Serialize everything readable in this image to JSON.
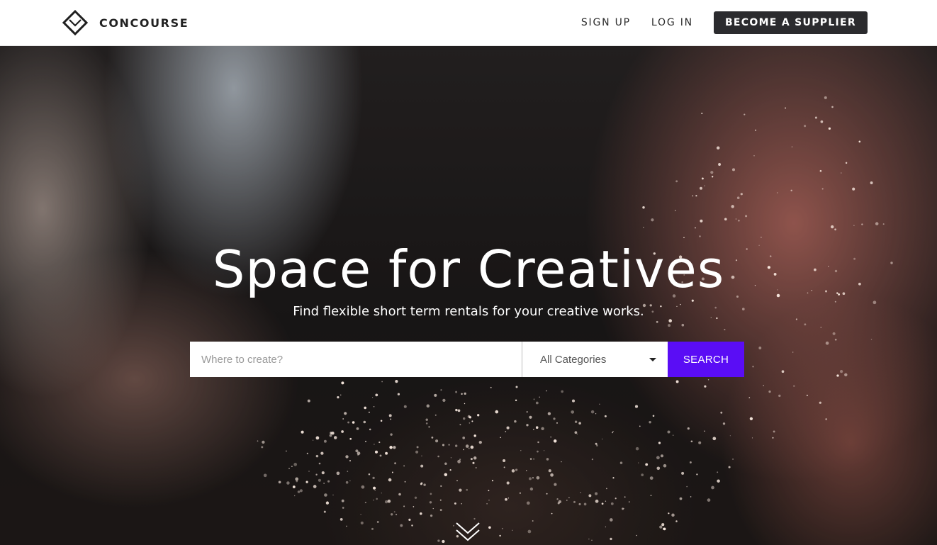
{
  "header": {
    "brand_name": "CONCOURSE",
    "brand_icon": "diamond-logo-icon",
    "nav": {
      "sign_up": "SIGN UP",
      "log_in": "LOG IN",
      "become_supplier": "BECOME A SUPPLIER"
    }
  },
  "hero": {
    "title": "Space for Creatives",
    "subtitle": "Find flexible short term rentals for your creative works.",
    "background": "photo of hands clapping with flying dust particles",
    "search": {
      "placeholder": "Where to create?",
      "value": "",
      "category_selected": "All Categories",
      "category_icon": "caret-down-icon",
      "button_label": "SEARCH"
    },
    "scroll_icon": "double-chevron-down-icon"
  },
  "colors": {
    "accent": "#5a0df5",
    "header_bg": "#ffffff",
    "cta_bg": "#2b2b2e",
    "text_light": "#ffffff"
  }
}
